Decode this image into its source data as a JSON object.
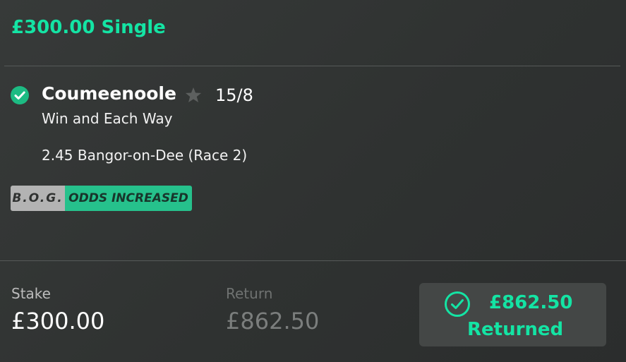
{
  "bet": {
    "title": "£300.00 Single"
  },
  "selection": {
    "status_icon": "check-circle-icon",
    "name": "Coumeenoole",
    "favourite_icon": "star-icon",
    "odds": "15/8",
    "market": "Win and Each Way",
    "event": "2.45 Bangor-on-Dee (Race 2)"
  },
  "badges": {
    "bog": "B.O.G.",
    "odds_increased": "ODDS INCREASED"
  },
  "summary": {
    "stake_label": "Stake",
    "stake_value": "£300.00",
    "return_label": "Return",
    "return_value": "£862.50",
    "returned_icon": "check-circle-outline-icon",
    "returned_amount": "£862.50",
    "returned_label": "Returned"
  },
  "colors": {
    "accent": "#14e4a4",
    "background": "#323534",
    "badge_green": "#26c18c",
    "badge_grey": "#b3b3b3",
    "check_green": "#1dbb83"
  }
}
